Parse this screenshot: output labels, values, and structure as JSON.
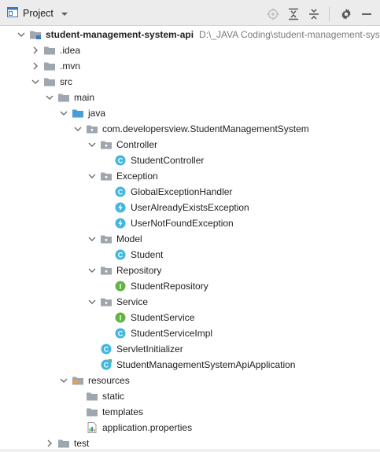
{
  "toolbar": {
    "title": "Project",
    "view_icon": "project-view-icon",
    "dropdown_icon": "chevron-down-icon",
    "actions": [
      "locate-icon",
      "expand-all-icon",
      "collapse-all-icon",
      "gear-icon",
      "minimize-icon"
    ]
  },
  "tree": [
    {
      "label": "student-management-system-api",
      "path": "D:\\_JAVA Coding\\student-management-system",
      "icon": "module-folder-icon",
      "arrow": "expanded",
      "bold": true
    },
    {
      "label": ".idea",
      "icon": "folder-icon",
      "arrow": "collapsed"
    },
    {
      "label": ".mvn",
      "icon": "folder-icon",
      "arrow": "collapsed"
    },
    {
      "label": "src",
      "icon": "folder-icon",
      "arrow": "expanded"
    },
    {
      "label": "main",
      "icon": "folder-icon",
      "arrow": "expanded"
    },
    {
      "label": "java",
      "icon": "source-folder-icon",
      "arrow": "expanded"
    },
    {
      "label": "com.developersview.StudentManagementSystem",
      "icon": "package-icon",
      "arrow": "expanded"
    },
    {
      "label": "Controller",
      "icon": "package-icon",
      "arrow": "expanded"
    },
    {
      "label": "StudentController",
      "icon": "class-icon",
      "arrow": "none"
    },
    {
      "label": "Exception",
      "icon": "package-icon",
      "arrow": "expanded"
    },
    {
      "label": "GlobalExceptionHandler",
      "icon": "class-icon",
      "arrow": "none"
    },
    {
      "label": "UserAlreadyExistsException",
      "icon": "exception-class-icon",
      "arrow": "none"
    },
    {
      "label": "UserNotFoundException",
      "icon": "exception-class-icon",
      "arrow": "none"
    },
    {
      "label": "Model",
      "icon": "package-icon",
      "arrow": "expanded"
    },
    {
      "label": "Student",
      "icon": "class-icon",
      "arrow": "none"
    },
    {
      "label": "Repository",
      "icon": "package-icon",
      "arrow": "expanded"
    },
    {
      "label": "StudentRepository",
      "icon": "interface-icon",
      "arrow": "none"
    },
    {
      "label": "Service",
      "icon": "package-icon",
      "arrow": "expanded"
    },
    {
      "label": "StudentService",
      "icon": "interface-icon",
      "arrow": "none"
    },
    {
      "label": "StudentServiceImpl",
      "icon": "class-icon",
      "arrow": "none"
    },
    {
      "label": "ServletInitializer",
      "icon": "class-icon",
      "arrow": "none"
    },
    {
      "label": "StudentManagementSystemApiApplication",
      "icon": "spring-boot-class-icon",
      "arrow": "none"
    },
    {
      "label": "resources",
      "icon": "resources-folder-icon",
      "arrow": "expanded"
    },
    {
      "label": "static",
      "icon": "folder-icon",
      "arrow": "none"
    },
    {
      "label": "templates",
      "icon": "folder-icon",
      "arrow": "none"
    },
    {
      "label": "application.properties",
      "icon": "properties-file-icon",
      "arrow": "none"
    },
    {
      "label": "test",
      "icon": "folder-icon",
      "arrow": "collapsed"
    }
  ],
  "colors": {
    "folder": "#9fa6ad",
    "source_folder": "#4a9cd6",
    "class": "#40b6e0",
    "interface": "#62b543",
    "resources_bars": "#f2a33a"
  }
}
